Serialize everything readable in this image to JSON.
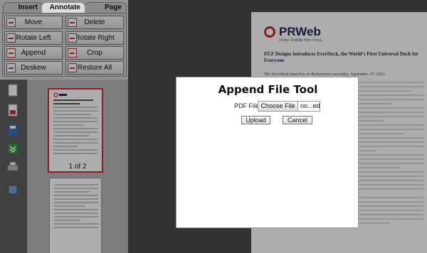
{
  "tabs": [
    {
      "label": "Insert"
    },
    {
      "label": "Annotate"
    },
    {
      "label": "Page"
    }
  ],
  "tools": [
    {
      "label": "Move",
      "icon": "move-icon"
    },
    {
      "label": "Delete",
      "icon": "delete-icon"
    },
    {
      "label": "Rotate Left",
      "icon": "rotate-left-icon"
    },
    {
      "label": "Rotate Right",
      "icon": "rotate-right-icon"
    },
    {
      "label": "Append",
      "icon": "append-icon"
    },
    {
      "label": "Crop",
      "icon": "crop-icon"
    },
    {
      "label": "Deskew",
      "icon": "deskew-icon"
    },
    {
      "label": "Restore All",
      "icon": "restore-icon"
    }
  ],
  "sidebar_icons": [
    "page-view-icon",
    "pdf-icon",
    "save-icon",
    "download-icon",
    "print-icon",
    "layout-icon"
  ],
  "thumbnails": {
    "selected_label": "1 of 2"
  },
  "document": {
    "logo_text": "PRWeb",
    "logo_subtext": "Online Visibility from Vocus",
    "title": "FÜZ Designs Introduces EverDock, the World's First Universal Dock for Everyone",
    "italic_line": "The EverDock launches on Kickstarter.com today, September 17, 2013."
  },
  "modal": {
    "title": "Append File Tool",
    "file_label": "PDF File:",
    "choose_button": "Choose File",
    "file_name": "no...ed",
    "upload_button": "Upload",
    "cancel_button": "Cancel"
  },
  "colors": {
    "accent_red": "#d62b2b",
    "logo_navy": "#1d2a5c",
    "panel_gray": "#d9d9d9"
  }
}
